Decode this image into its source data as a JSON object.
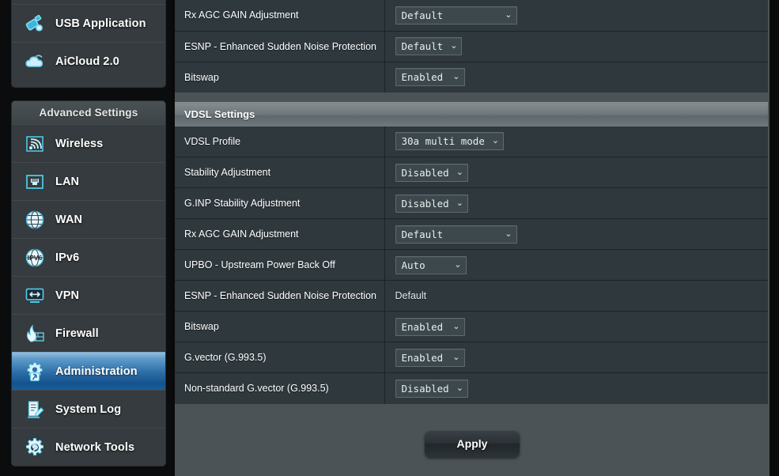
{
  "sidebar": {
    "top_block": {
      "items": [
        {
          "label": "",
          "icon": "globe-partial-icon",
          "partial": true
        },
        {
          "label": "USB Application",
          "icon": "usb-icon"
        },
        {
          "label": "AiCloud 2.0",
          "icon": "cloud-icon"
        }
      ]
    },
    "advanced": {
      "header": "Advanced Settings",
      "items": [
        {
          "label": "Wireless",
          "icon": "wireless-icon",
          "selected": false
        },
        {
          "label": "LAN",
          "icon": "lan-port-icon",
          "selected": false
        },
        {
          "label": "WAN",
          "icon": "globe-icon",
          "selected": false
        },
        {
          "label": "IPv6",
          "icon": "ipv6-globe-icon",
          "selected": false
        },
        {
          "label": "VPN",
          "icon": "vpn-monitor-icon",
          "selected": false
        },
        {
          "label": "Firewall",
          "icon": "firewall-flame-icon",
          "selected": false
        },
        {
          "label": "Administration",
          "icon": "gear-admin-icon",
          "selected": true
        },
        {
          "label": "System Log",
          "icon": "log-pencil-icon",
          "selected": false
        },
        {
          "label": "Network Tools",
          "icon": "gear-wrench-icon",
          "selected": false
        }
      ]
    }
  },
  "main": {
    "adsl_rows": [
      {
        "label": "Rx AGC GAIN Adjustment",
        "control": "select",
        "value": "Default",
        "width": "wide"
      },
      {
        "label": "ESNP - Enhanced Sudden Noise Protection",
        "control": "select",
        "value": "Default",
        "width": "auto"
      },
      {
        "label": "Bitswap",
        "control": "select",
        "value": "Enabled",
        "width": "small"
      }
    ],
    "vdsl_section": {
      "title": "VDSL Settings",
      "rows": [
        {
          "label": "VDSL Profile",
          "control": "select",
          "value": "30a multi mode",
          "width": "auto"
        },
        {
          "label": "Stability Adjustment",
          "control": "select",
          "value": "Disabled",
          "width": "auto"
        },
        {
          "label": "G.INP Stability Adjustment",
          "control": "select",
          "value": "Disabled",
          "width": "auto"
        },
        {
          "label": "Rx AGC GAIN Adjustment",
          "control": "select",
          "value": "Default",
          "width": "wide"
        },
        {
          "label": "UPBO - Upstream Power Back Off",
          "control": "select",
          "value": "Auto",
          "width": "med"
        },
        {
          "label": "ESNP - Enhanced Sudden Noise Protection",
          "control": "text",
          "value": "Default",
          "width": ""
        },
        {
          "label": "Bitswap",
          "control": "select",
          "value": "Enabled",
          "width": "small"
        },
        {
          "label": "G.vector (G.993.5)",
          "control": "select",
          "value": "Enabled",
          "width": "small"
        },
        {
          "label": "Non-standard G.vector (G.993.5)",
          "control": "select",
          "value": "Disabled",
          "width": "auto"
        }
      ]
    },
    "apply_label": "Apply",
    "dropdown_arrow": "⌄"
  },
  "colors": {
    "accent_blue": "#2f6fa8",
    "row_bg": "#2e383d",
    "panel_bg": "#4b5357",
    "sidebar_bg": "#353b3e"
  }
}
